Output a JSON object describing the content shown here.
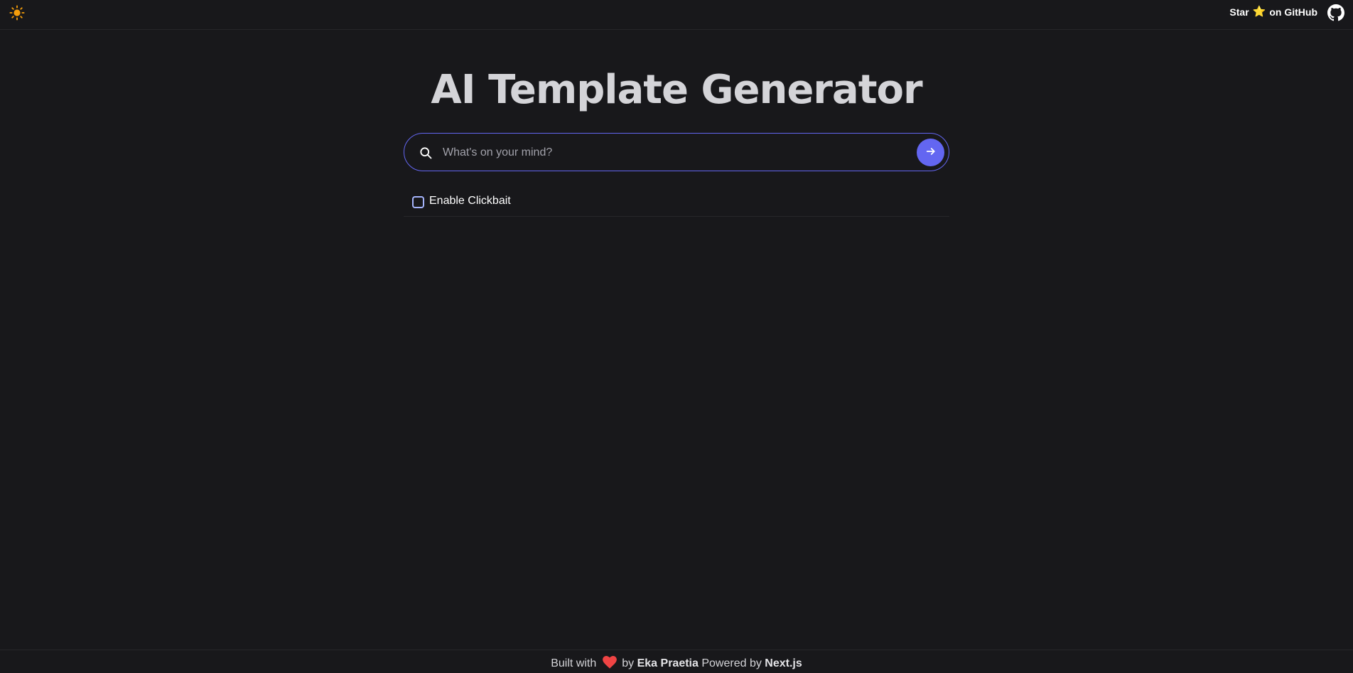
{
  "header": {
    "theme_icon": "sun-icon",
    "github_star_prefix": "Star",
    "github_star_emoji": "⭐",
    "github_star_suffix": "on GitHub",
    "github_icon": "github-icon"
  },
  "main": {
    "title": "AI Template Generator",
    "search": {
      "placeholder": "What's on your mind?",
      "value": ""
    },
    "options": {
      "clickbait_label": "Enable Clickbait",
      "clickbait_checked": false
    }
  },
  "footer": {
    "built_with": "Built with",
    "by": "by",
    "author": "Eka Praetia",
    "powered_by": "Powered by",
    "framework": "Next.js"
  },
  "colors": {
    "background": "#18181b",
    "accent": "#6366f1",
    "heart": "#ef4444",
    "sun": "#f59e0b"
  }
}
